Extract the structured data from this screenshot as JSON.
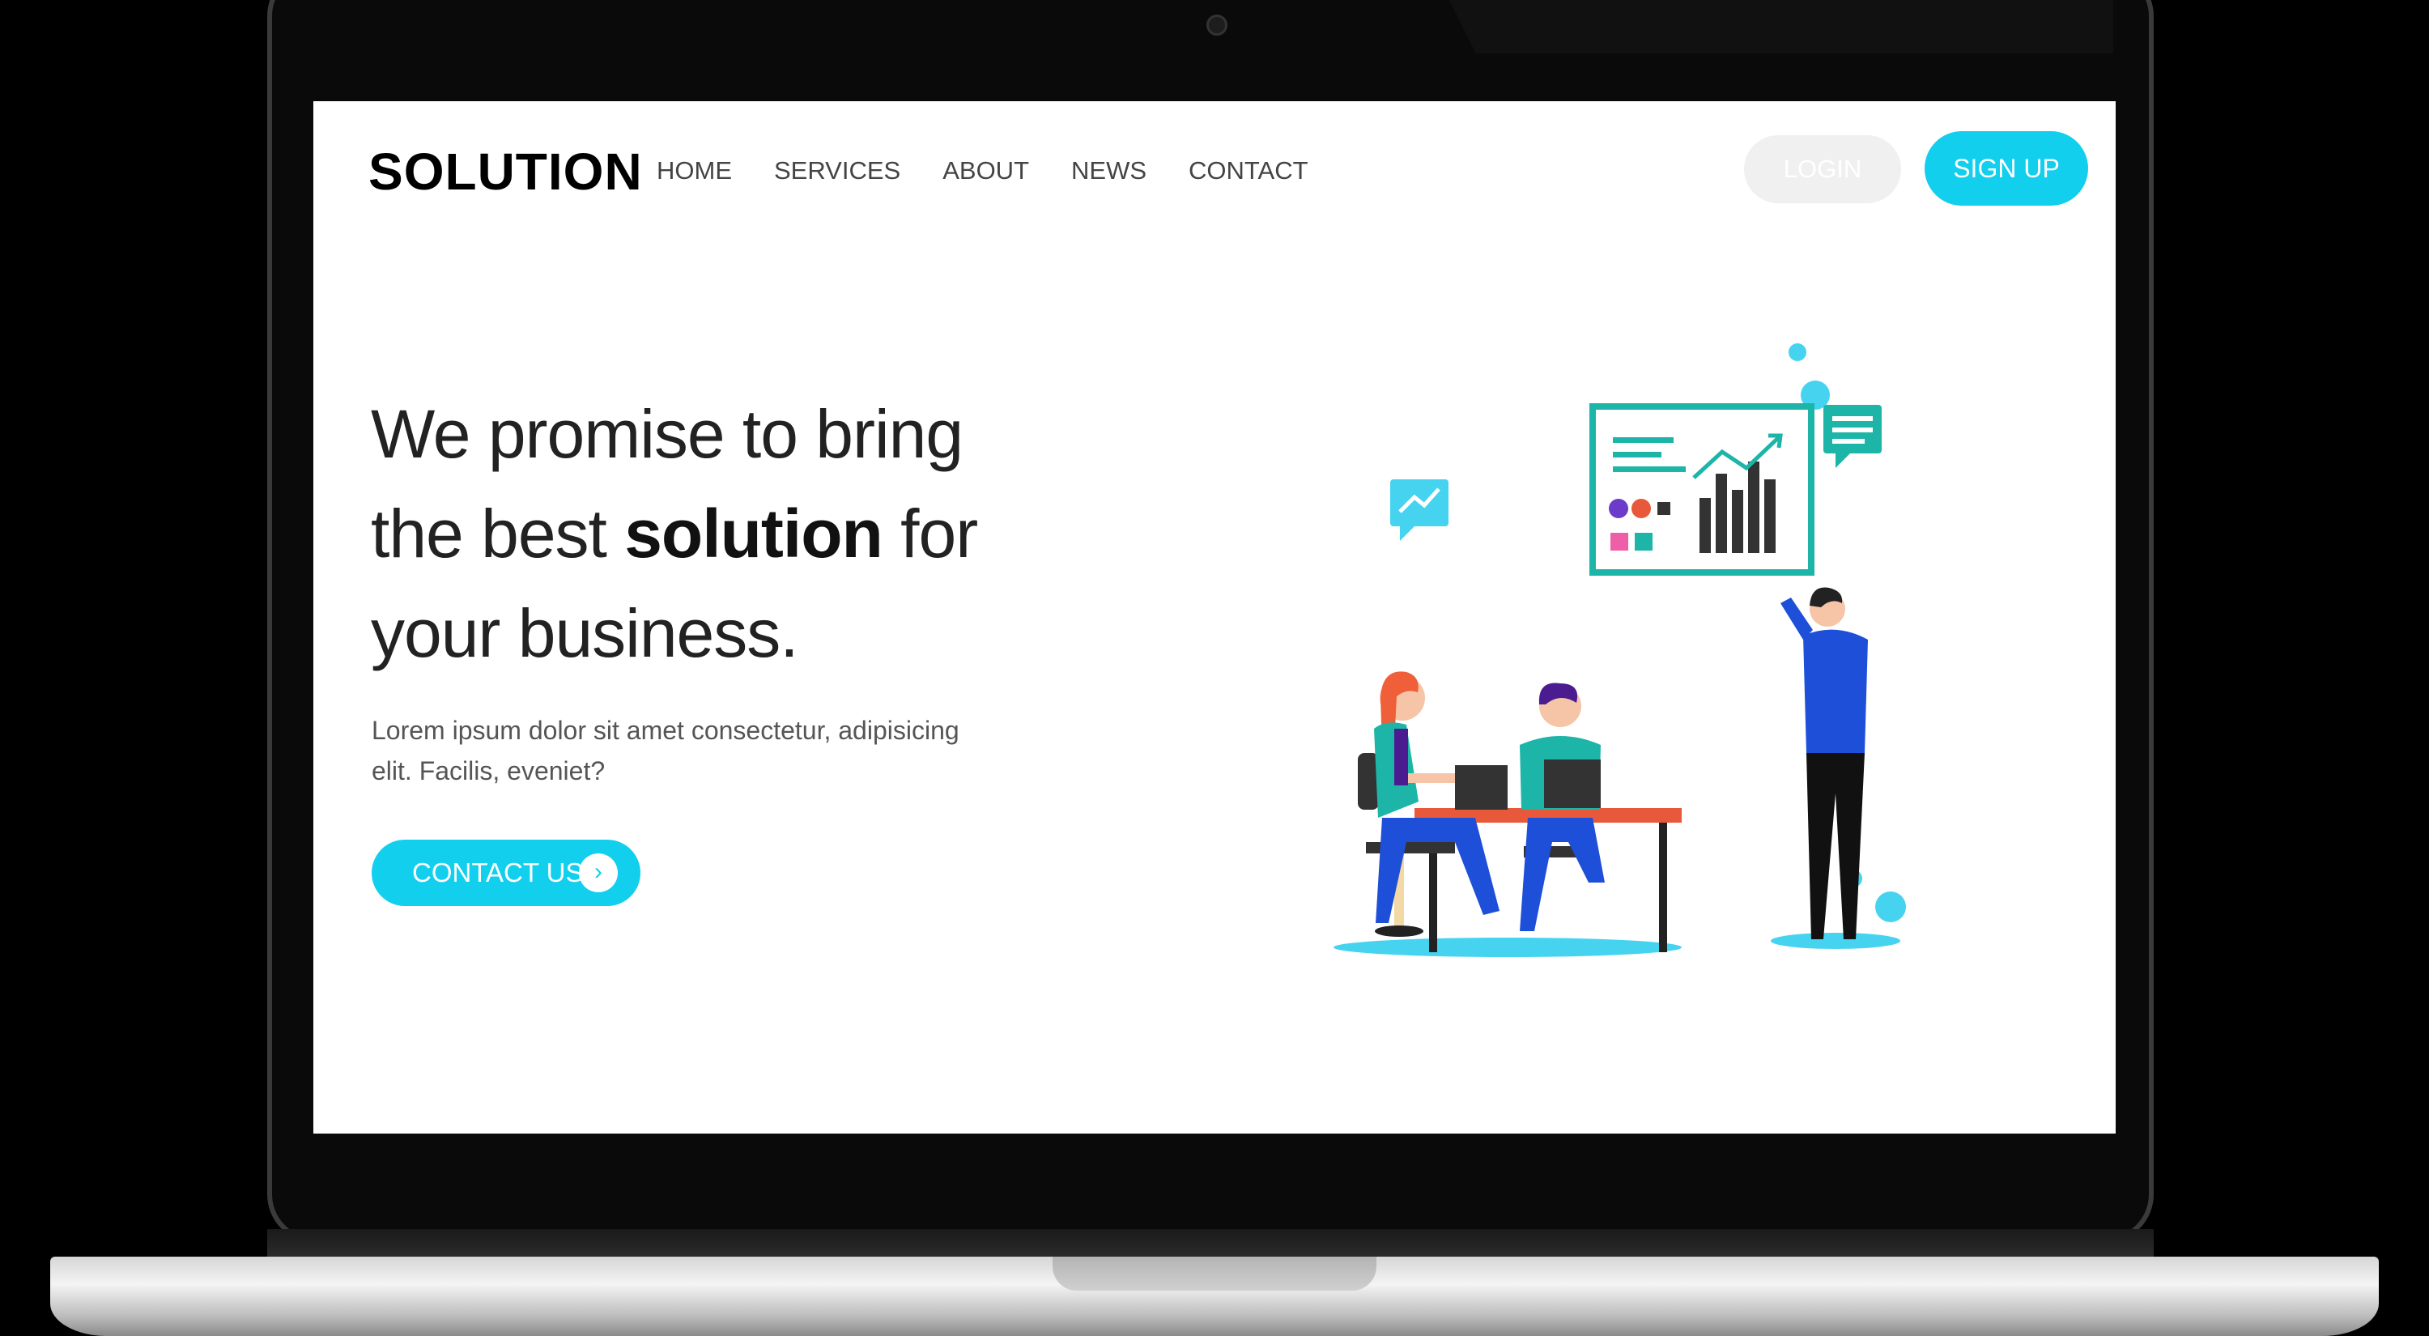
{
  "header": {
    "logo": "SOLUTION",
    "nav": [
      "HOME",
      "SERVICES",
      "ABOUT",
      "NEWS",
      "CONTACT"
    ],
    "login_label": "LOGIN",
    "signup_label": "SIGN UP"
  },
  "hero": {
    "title_part1": "We promise to bring the best ",
    "title_bold": "solution",
    "title_part2": " for your business.",
    "description": "Lorem ipsum dolor sit amet consectetur, adipisicing elit. Facilis, eveniet?",
    "cta_label": "CONTACT US",
    "cta_icon": "chevron-right-icon"
  },
  "colors": {
    "accent": "#12cfee",
    "login_bg": "#f0f0f0",
    "illustration_teal": "#1cb5a8",
    "illustration_blue": "#1e4fd8",
    "illustration_orange": "#e8583a"
  }
}
